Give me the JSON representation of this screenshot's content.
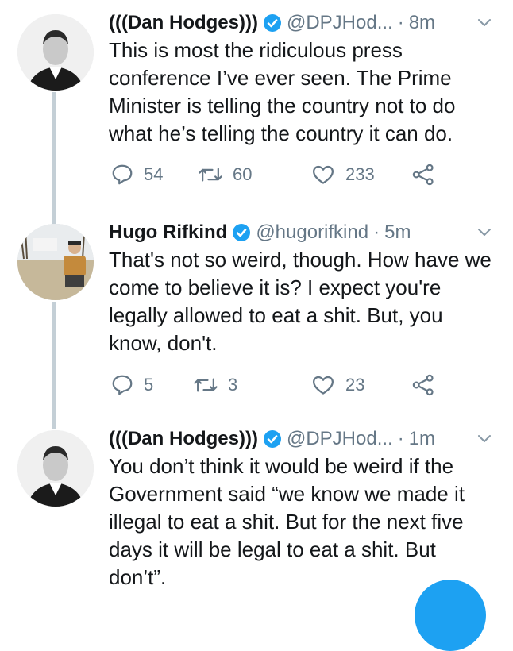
{
  "tweets": [
    {
      "name": "(((Dan Hodges)))",
      "handle": "@DPJHod...",
      "separator": "·",
      "time": "8m",
      "text": "This is most the ridiculous press conference I’ve ever seen. The Prime Minister is telling the country not to do what he’s telling the country it can do.",
      "replies": "54",
      "retweets": "60",
      "likes": "233"
    },
    {
      "name": "Hugo Rifkind",
      "handle": "@hugorifkind",
      "separator": "·",
      "time": "5m",
      "text": "That's not so weird, though. How have we come to believe it is? I expect you're legally allowed to eat a shit. But, you know, don't.",
      "replies": "5",
      "retweets": "3",
      "likes": "23"
    },
    {
      "name": "(((Dan Hodges)))",
      "handle": "@DPJHod...",
      "separator": "·",
      "time": "1m",
      "text": "You don’t think it would be weird if the Government said “we know we made  it illegal to eat a shit. But for the next five days it will be legal to eat a shit. But don’t”."
    }
  ],
  "colors": {
    "verified": "#1da1f2",
    "muted": "#657786",
    "thread_line": "#c4cfd6",
    "fab": "#1da1f2"
  },
  "icons": [
    "verified-badge-icon",
    "chevron-down-icon",
    "reply-icon",
    "retweet-icon",
    "like-icon",
    "share-icon"
  ]
}
